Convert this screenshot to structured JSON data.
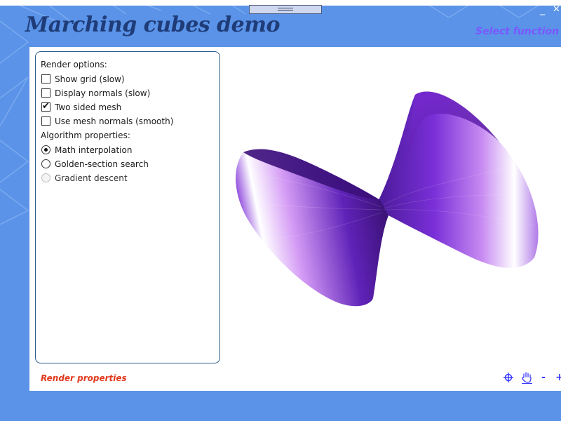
{
  "window": {
    "title": "Marching cubes demo",
    "minimize_glyph": "_",
    "close_glyph": "✕"
  },
  "header": {
    "select_function_label": "Select function"
  },
  "options_panel": {
    "render_options_title": "Render options:",
    "render_options": [
      {
        "label": "Show grid (slow)",
        "checked": false
      },
      {
        "label": "Display normals (slow)",
        "checked": false
      },
      {
        "label": "Two sided mesh",
        "checked": true
      },
      {
        "label": "Use mesh normals (smooth)",
        "checked": false
      }
    ],
    "algorithm_title": "Algorithm properties:",
    "algorithm_options": [
      {
        "label": "Math interpolation",
        "selected": true,
        "enabled": true
      },
      {
        "label": "Golden-section search",
        "selected": false,
        "enabled": true
      },
      {
        "label": "Gradient descent",
        "selected": false,
        "enabled": false
      }
    ]
  },
  "footer": {
    "render_properties_label": "Render properties",
    "zoom_out_glyph": "-",
    "zoom_in_glyph": "+"
  },
  "icons": {
    "crosshair": "crosshair-icon",
    "pan": "hand-icon",
    "check": "✔"
  },
  "colors": {
    "background": "#5a93e8",
    "title": "#1f3c78",
    "select_function": "#7b57ff",
    "render_properties": "#e03a1e",
    "mesh_dark": "#2e0c5e",
    "mesh_mid": "#8a3ee8",
    "mesh_light": "#ffffff"
  }
}
